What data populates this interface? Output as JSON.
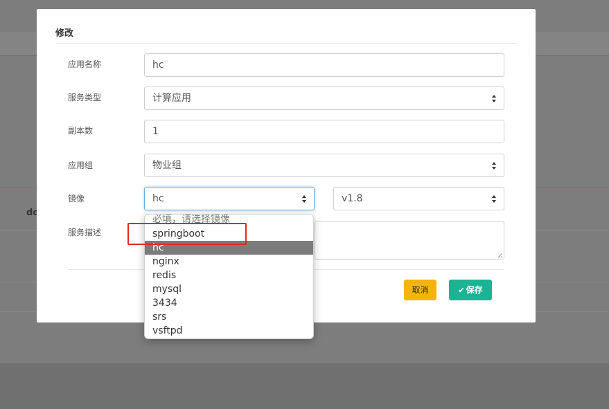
{
  "background": {
    "partial_text": "do"
  },
  "modal": {
    "title": "修改",
    "fields": {
      "app_name": {
        "label": "应用名称",
        "value": "hc"
      },
      "service_type": {
        "label": "服务类型",
        "value": "计算应用"
      },
      "replicas": {
        "label": "副本数",
        "value": "1"
      },
      "app_group": {
        "label": "应用组",
        "value": "物业组"
      },
      "image": {
        "label": "镜像",
        "value": "hc",
        "version": "v1.8"
      },
      "description": {
        "label": "服务描述",
        "value": ""
      }
    },
    "buttons": {
      "cancel": "取消",
      "save": "保存"
    }
  },
  "image_dropdown": {
    "options": [
      {
        "label": "必填，请选择镜像",
        "kind": "placeholder"
      },
      {
        "label": "springboot"
      },
      {
        "label": "hc",
        "selected": true
      },
      {
        "label": "nginx"
      },
      {
        "label": "redis"
      },
      {
        "label": "mysql"
      },
      {
        "label": "3434"
      },
      {
        "label": "srs"
      },
      {
        "label": "vsftpd"
      }
    ]
  },
  "colors": {
    "overlay": "#7d7d7d",
    "cancel_button": "#f5b40d",
    "save_button": "#1bb394",
    "selected_option": "#7b7b7b",
    "annotation": "#e2261f",
    "focus_border": "#66afe9"
  }
}
